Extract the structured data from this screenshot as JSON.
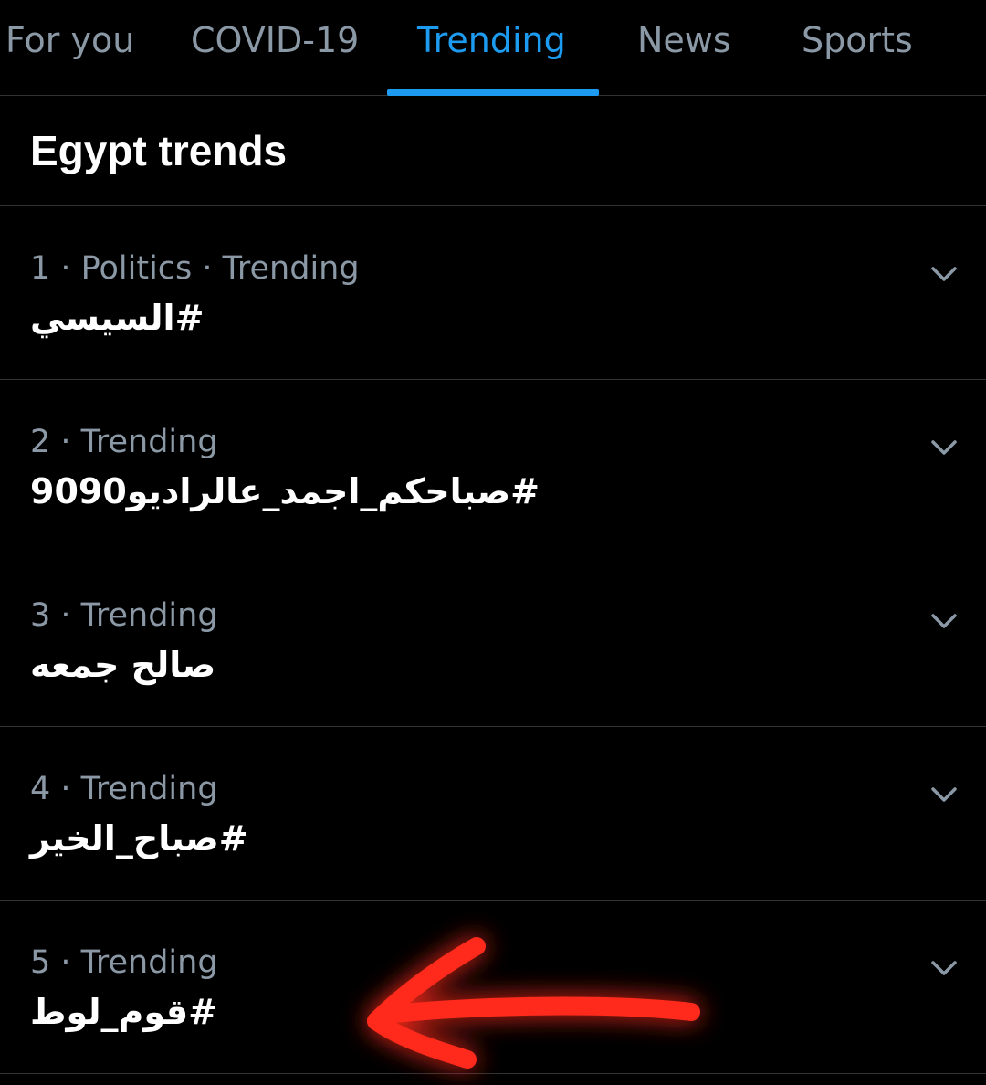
{
  "tabs": [
    {
      "label": "For you"
    },
    {
      "label": "COVID-19"
    },
    {
      "label": "Trending"
    },
    {
      "label": "News"
    },
    {
      "label": "Sports"
    }
  ],
  "active_tab": "Trending",
  "section": {
    "title": "Egypt trends"
  },
  "trends": [
    {
      "meta": "1 · Politics · Trending",
      "name": "#السيسي"
    },
    {
      "meta": "2 · Trending",
      "name": "#صباحكم_اجمد_عالراديو9090"
    },
    {
      "meta": "3 · Trending",
      "name": "صالح جمعه"
    },
    {
      "meta": "4 · Trending",
      "name": "#صباح_الخير"
    },
    {
      "meta": "5 · Trending",
      "name": "#قوم_لوط"
    }
  ],
  "icons": {
    "trend_more": "chevron-down-icon",
    "annotation": "red-arrow-annotation"
  },
  "colors": {
    "background": "#000000",
    "accent": "#1d9bf0",
    "muted_text": "#8b98a5",
    "divider": "#2f3336",
    "annotation": "#ff2a1f"
  }
}
